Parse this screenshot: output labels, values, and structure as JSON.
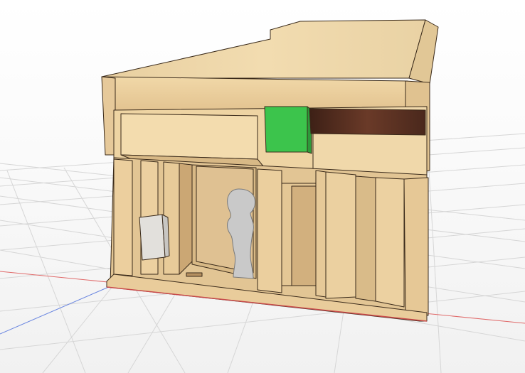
{
  "viewport": {
    "kind": "3d-model-canvas",
    "colors": {
      "background_top": "#ffffff",
      "background_bottom": "#f0f0f0",
      "grid": "#d4d4d4",
      "x_axis": "#e05050",
      "z_axis": "#5a78e0",
      "wood_light": "#ecd4a6",
      "wood_mid": "#dcbb88",
      "wood_dark": "#b8915e",
      "edge": "#3a2a1a",
      "green_panel": "#39c24a",
      "dark_wood_strip": "#5a2f22",
      "white_box": "#e2e0dc",
      "figure": "#c9c9c9"
    },
    "model_parts": [
      "roof-slab",
      "front-fascia",
      "sign-board",
      "green-panel",
      "dark-wood-strip",
      "lower-facade",
      "left-pillars",
      "recessed-shop",
      "white-utility-box",
      "silhouette-figure",
      "right-doorway",
      "base-plate"
    ]
  }
}
